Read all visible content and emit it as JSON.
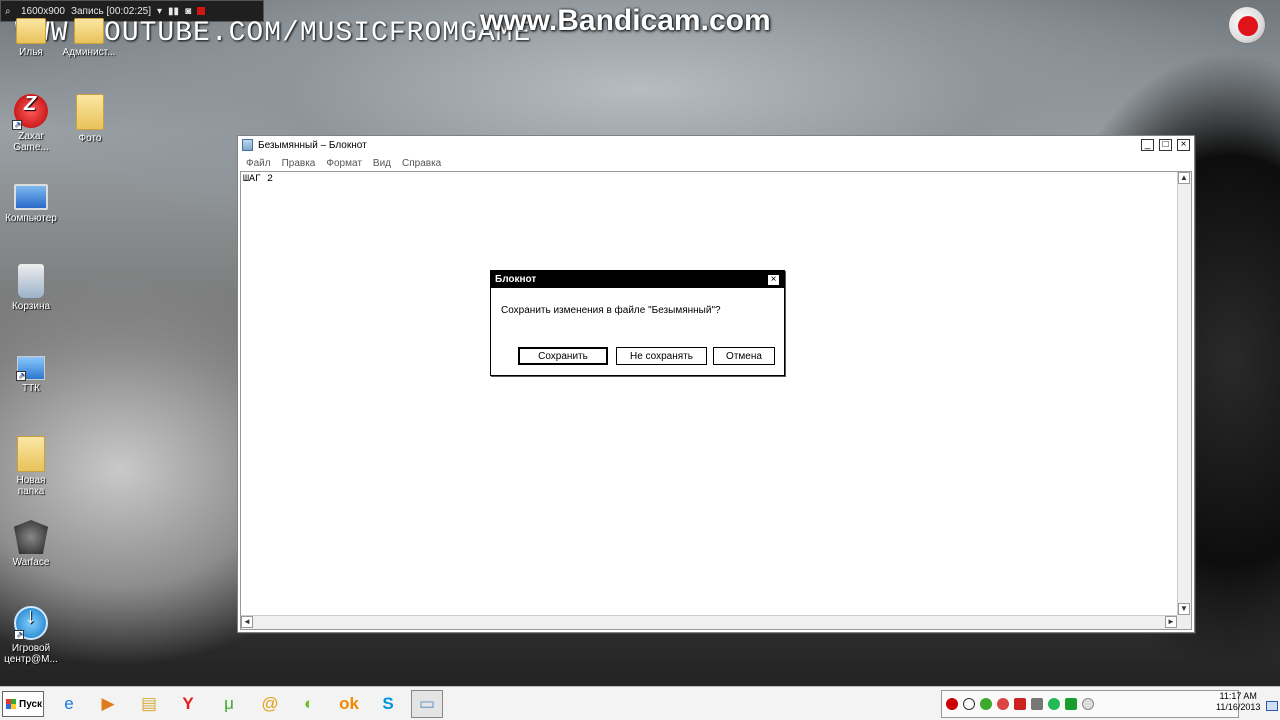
{
  "recorder": {
    "resolution": "1600x900",
    "status": "Запись [00:02:25]"
  },
  "watermarks": {
    "url": "WWW.YOUTUBE.COM/MUSICFROMGAME",
    "brand": "www.Bandicam.com"
  },
  "desktop_icons": [
    {
      "label": "Илья",
      "icon": "folder-icon"
    },
    {
      "label": "Админист...",
      "icon": "folder-icon"
    },
    {
      "label": "Zaxar Game...",
      "icon": "zaxar-icon"
    },
    {
      "label": "Фото",
      "icon": "folder-icon"
    },
    {
      "label": "Компьютер",
      "icon": "computer-icon"
    },
    {
      "label": "Корзина",
      "icon": "recycle-bin-icon"
    },
    {
      "label": "ТТК",
      "icon": "network-icon"
    },
    {
      "label": "Новая папка",
      "icon": "folder-icon"
    },
    {
      "label": "Warface",
      "icon": "warface-icon"
    },
    {
      "label": "Игровой центр@М...",
      "icon": "game-center-icon"
    }
  ],
  "notepad": {
    "title": "Безымянный – Блокнот",
    "menu": [
      "Файл",
      "Правка",
      "Формат",
      "Вид",
      "Справка"
    ],
    "content": "ШАГ 2",
    "buttons": {
      "minimize": "_",
      "maximize": "□",
      "close": "×"
    }
  },
  "dialog": {
    "title": "Блокнот",
    "message": "Сохранить изменения в файле \"Безымянный\"?",
    "save": "Сохранить",
    "dont_save": "Не сохранять",
    "cancel": "Отмена",
    "close": "×"
  },
  "taskbar": {
    "start_label": "Пуск",
    "apps": [
      "internet-explorer-icon",
      "media-player-icon",
      "explorer-icon",
      "yandex-icon",
      "utorrent-icon",
      "mail-agent-icon",
      "picasa-icon",
      "odnoklassniki-icon",
      "skype-icon",
      "notepad-icon"
    ],
    "clock_time": "11:17 AM",
    "clock_date": "11/16/2013"
  },
  "colors": {
    "dialog_title_bg": "#000000",
    "recorder_red": "#d01515"
  }
}
